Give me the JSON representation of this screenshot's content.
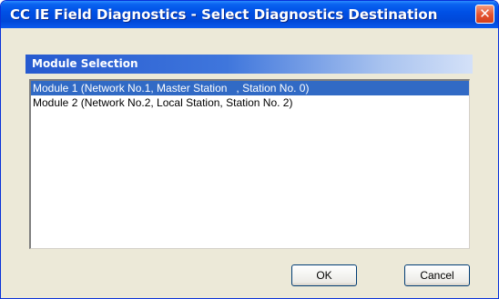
{
  "window": {
    "title": "CC IE Field Diagnostics - Select Diagnostics Destination",
    "close_glyph": "✕"
  },
  "section": {
    "title": "Module Selection"
  },
  "modules": [
    {
      "label": "Module 1 (Network No.1, Master Station   , Station No. 0)",
      "selected": true
    },
    {
      "label": "Module 2 (Network No.2, Local Station, Station No. 2)",
      "selected": false
    }
  ],
  "buttons": {
    "ok": "OK",
    "cancel": "Cancel"
  },
  "colors": {
    "titlebar": "#0050e6",
    "selection": "#316ac5",
    "close_button": "#e3512d"
  }
}
